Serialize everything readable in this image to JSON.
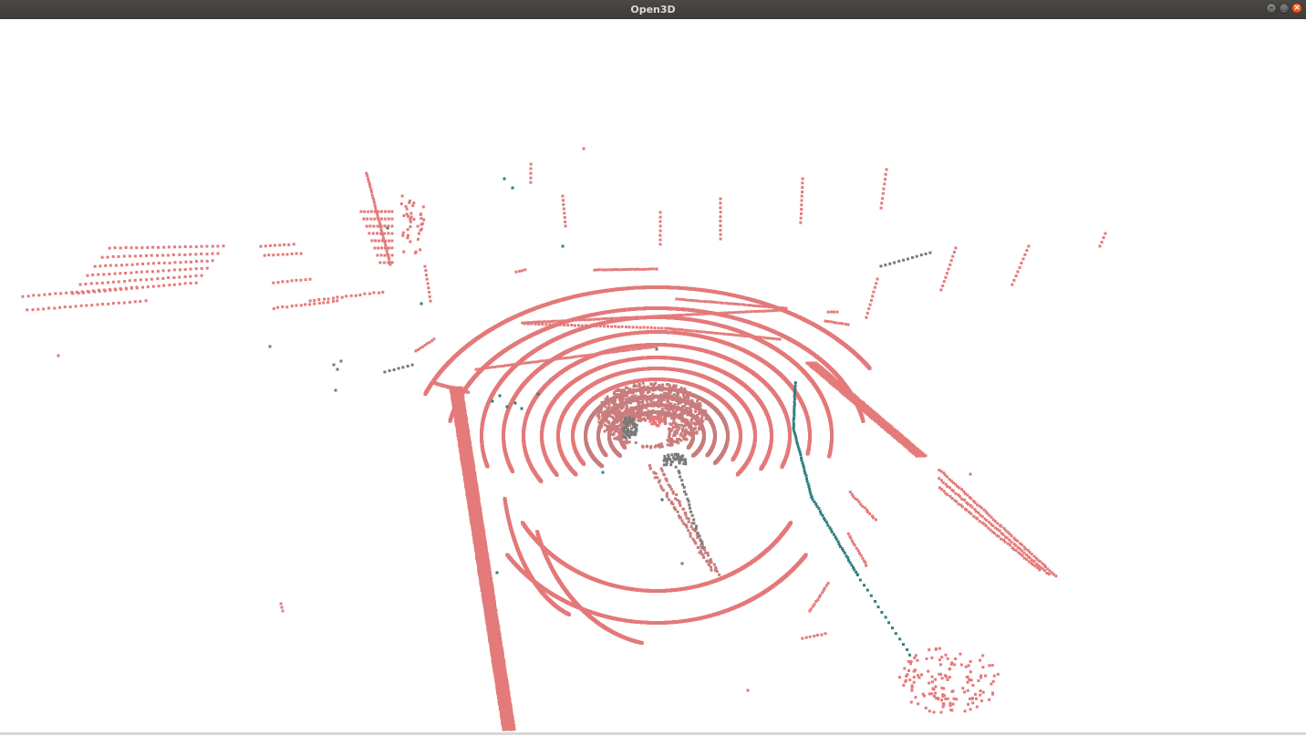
{
  "window": {
    "title": "Open3D",
    "controls": [
      {
        "name": "minimize-button",
        "glyph": "–"
      },
      {
        "name": "maximize-button",
        "glyph": "□"
      },
      {
        "name": "close-button",
        "glyph": "×"
      }
    ]
  },
  "viewport": {
    "background": "#ffffff",
    "point_colors": {
      "main": "#e47a7a",
      "near": "#c97d7d",
      "teal": "#2e7f80",
      "gray": "#7a7a7a"
    }
  }
}
